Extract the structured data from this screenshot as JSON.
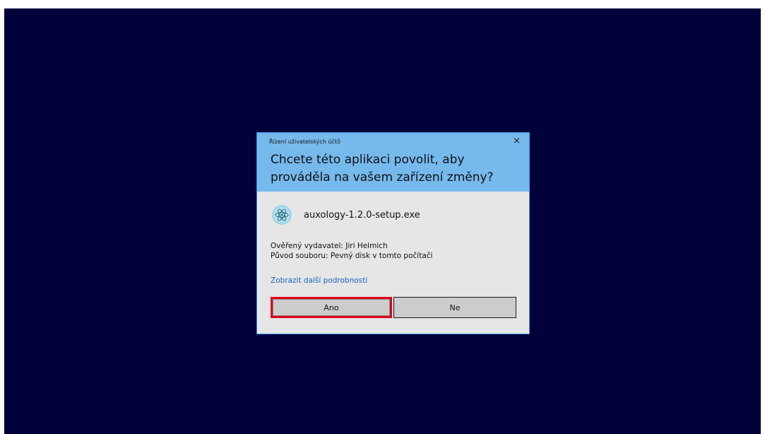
{
  "dialog": {
    "caption": "Řízení uživatelských účtů",
    "close_glyph": "×",
    "question": "Chcete této aplikaci povolit, aby prováděla na vašem zařízení změny?",
    "app_name": "auxology-1.2.0-setup.exe",
    "app_icon": "atom-icon",
    "publisher": "Ověřený vydavatel: Jiri Helmich",
    "origin": "Původ souboru: Pevný disk v tomto počítači",
    "more_details_link": "Zobrazit další podrobnosti",
    "yes_label": "Ano",
    "no_label": "Ne"
  },
  "colors": {
    "desktop_background": "#00003a",
    "header_background": "#76b9ed",
    "dialog_background": "#e6e6e6",
    "link": "#1566c0",
    "highlight": "#e0001a"
  }
}
